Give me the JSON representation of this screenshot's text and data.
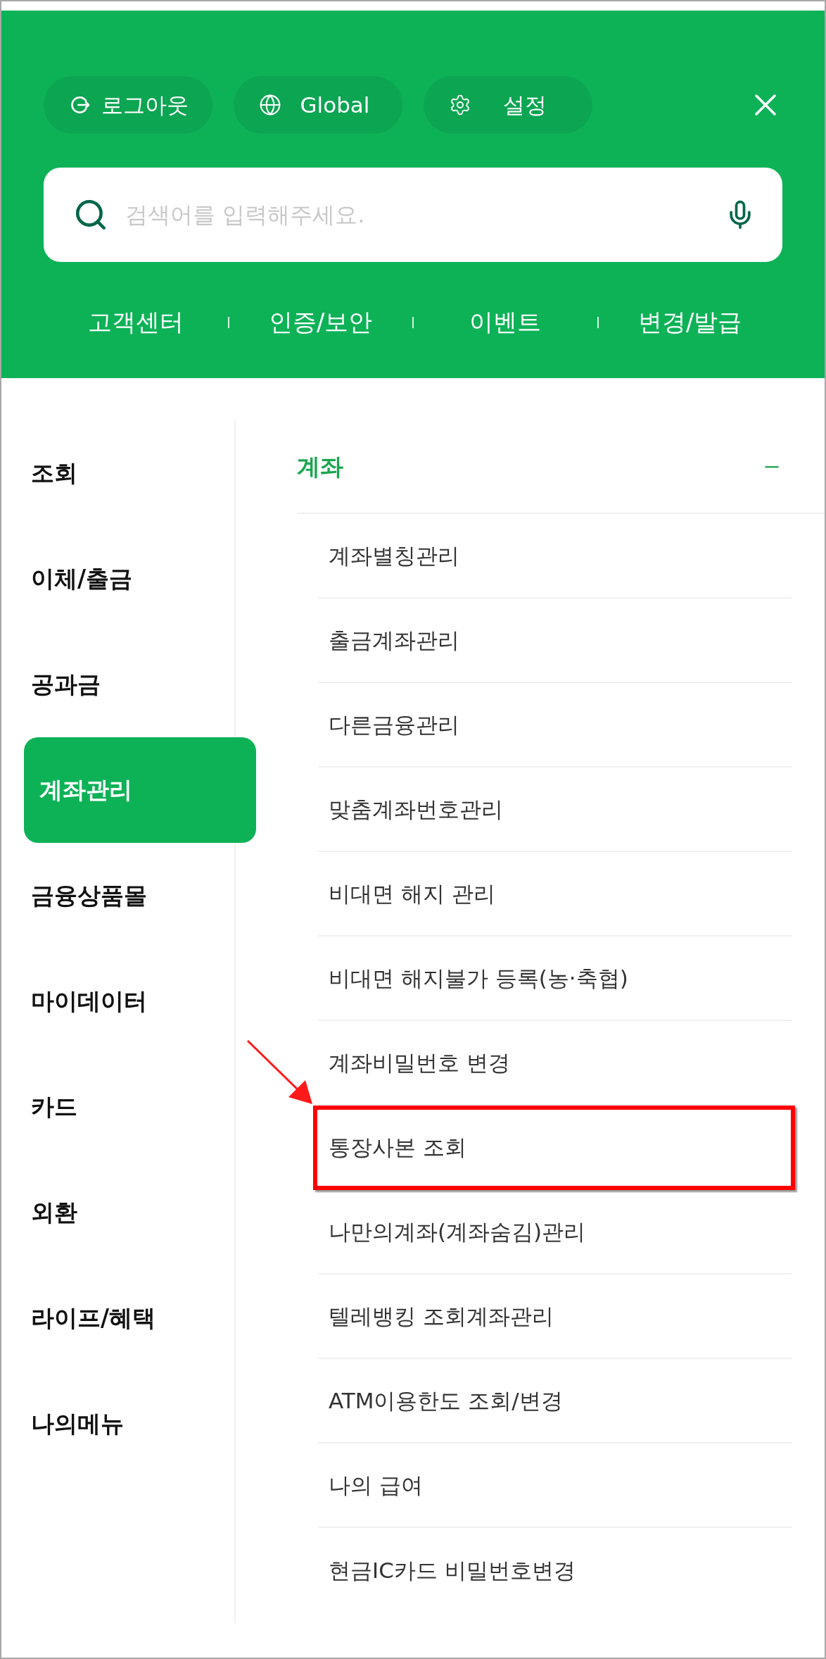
{
  "header_buttons": [
    {
      "kind": "logout",
      "label": "로그아웃"
    },
    {
      "kind": "globe",
      "label": "Global"
    },
    {
      "kind": "settings",
      "label": "설정"
    }
  ],
  "search": {
    "placeholder": "검색어를 입력해주세요."
  },
  "quick_links": [
    "고객센터",
    "인증/보안",
    "이벤트",
    "변경/발급"
  ],
  "sidebar": {
    "items": [
      {
        "label": "조회",
        "selected": false
      },
      {
        "label": "이체/출금",
        "selected": false
      },
      {
        "label": "공과금",
        "selected": false
      },
      {
        "label": "계좌관리",
        "selected": true
      },
      {
        "label": "금융상품몰",
        "selected": false
      },
      {
        "label": "마이데이터",
        "selected": false
      },
      {
        "label": "카드",
        "selected": false
      },
      {
        "label": "외환",
        "selected": false
      },
      {
        "label": "라이프/혜택",
        "selected": false
      },
      {
        "label": "나의메뉴",
        "selected": false
      }
    ]
  },
  "section": {
    "title": "계좌",
    "expanded": true,
    "items": [
      {
        "label": "계좌별칭관리",
        "highlighted": false
      },
      {
        "label": "출금계좌관리",
        "highlighted": false
      },
      {
        "label": "다른금융관리",
        "highlighted": false
      },
      {
        "label": "맞춤계좌번호관리",
        "highlighted": false
      },
      {
        "label": "비대면 해지 관리",
        "highlighted": false
      },
      {
        "label": "비대면 해지불가 등록(농·축협)",
        "highlighted": false
      },
      {
        "label": "계좌비밀번호 변경",
        "highlighted": false
      },
      {
        "label": "통장사본 조회",
        "highlighted": true
      },
      {
        "label": "나만의계좌(계좌숨김)관리",
        "highlighted": false
      },
      {
        "label": "텔레뱅킹 조회계좌관리",
        "highlighted": false
      },
      {
        "label": "ATM이용한도 조회/변경",
        "highlighted": false
      },
      {
        "label": "나의 급여",
        "highlighted": false
      },
      {
        "label": "현금IC카드 비밀번호변경",
        "highlighted": false
      }
    ]
  }
}
